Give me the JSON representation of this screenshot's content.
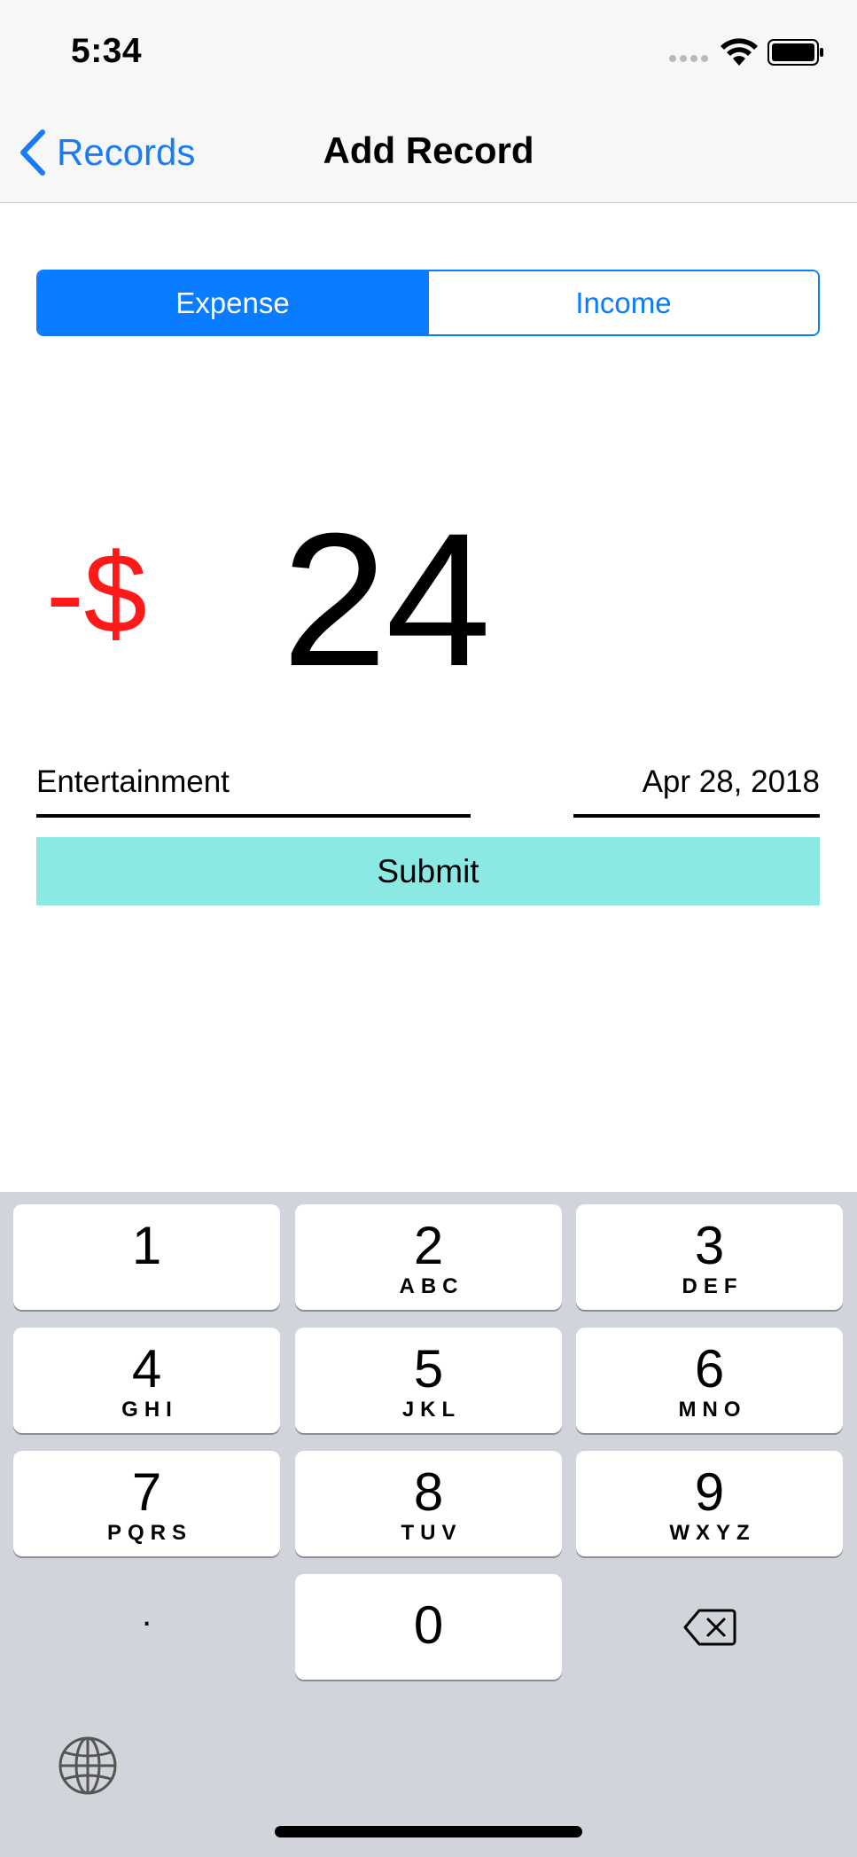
{
  "status_bar": {
    "time": "5:34"
  },
  "nav": {
    "back_label": "Records",
    "title": "Add Record"
  },
  "segmented": {
    "options": [
      "Expense",
      "Income"
    ],
    "selected": "Expense"
  },
  "amount": {
    "currency": "-$",
    "value": "24"
  },
  "fields": {
    "category": "Entertainment",
    "date": "Apr 28, 2018"
  },
  "submit_label": "Submit",
  "colors": {
    "accent": "#0a7cff",
    "negative": "#ff1a1a",
    "submit_bg": "#8ce8e3",
    "keyboard_bg": "#d1d4da"
  },
  "keypad": {
    "keys": [
      {
        "digit": "1",
        "letters": ""
      },
      {
        "digit": "2",
        "letters": "ABC"
      },
      {
        "digit": "3",
        "letters": "DEF"
      },
      {
        "digit": "4",
        "letters": "GHI"
      },
      {
        "digit": "5",
        "letters": "JKL"
      },
      {
        "digit": "6",
        "letters": "MNO"
      },
      {
        "digit": "7",
        "letters": "PQRS"
      },
      {
        "digit": "8",
        "letters": "TUV"
      },
      {
        "digit": "9",
        "letters": "WXYZ"
      },
      {
        "digit": "0",
        "letters": ""
      }
    ],
    "decimal": ".",
    "delete_icon": "delete-backspace-icon",
    "globe_icon": "globe-icon"
  }
}
